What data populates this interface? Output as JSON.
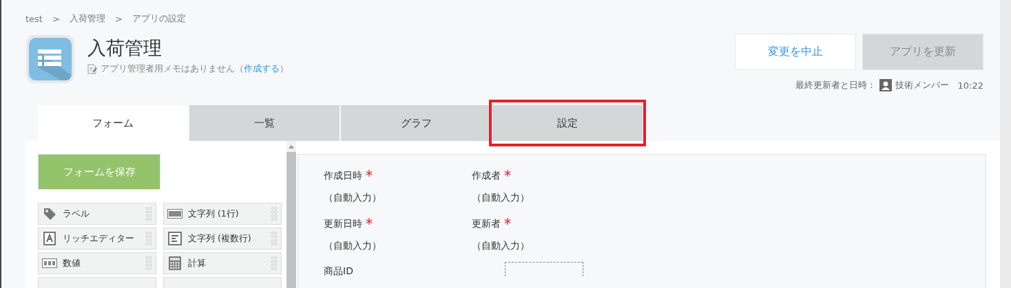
{
  "breadcrumb": [
    {
      "label": "test"
    },
    {
      "label": "入荷管理"
    },
    {
      "label": "アプリの設定"
    }
  ],
  "breadcrumb_separator": ">",
  "app": {
    "title": "入荷管理",
    "memo": "アプリ管理者用メモはありません（",
    "memo_link": "作成する",
    "memo_end": "）"
  },
  "buttons": [
    {
      "label": "変更を中止",
      "disabled": false
    },
    {
      "label": "アプリを更新",
      "disabled": true
    }
  ],
  "last_updated": {
    "label": "最終更新者と日時：",
    "user": "技術メンバー",
    "time": "10:22"
  },
  "tabs": [
    {
      "label": "フォーム",
      "selected": true,
      "highlighted": false
    },
    {
      "label": "一覧",
      "selected": false,
      "highlighted": false
    },
    {
      "label": "グラフ",
      "selected": false,
      "highlighted": false
    },
    {
      "label": "設定",
      "selected": false,
      "highlighted": true
    }
  ],
  "save_button": "フォームを保存",
  "palette": [
    {
      "label": "ラベル",
      "kind": "label"
    },
    {
      "label": "文字列 (1行)",
      "kind": "text"
    },
    {
      "label": "リッチエディター",
      "kind": "rich"
    },
    {
      "label": "文字列 (複数行)",
      "kind": "multiline"
    },
    {
      "label": "数値",
      "kind": "number"
    },
    {
      "label": "計算",
      "kind": "calc"
    }
  ],
  "fields": [
    {
      "label": "作成日時",
      "required": true,
      "value": "（自動入力）"
    },
    {
      "label": "作成者",
      "required": true,
      "value": "（自動入力）"
    },
    {
      "label": "更新日時",
      "required": true,
      "value": "（自動入力）"
    },
    {
      "label": "更新者",
      "required": true,
      "value": "（自動入力）"
    }
  ],
  "next_field": {
    "label": "商品ID"
  }
}
